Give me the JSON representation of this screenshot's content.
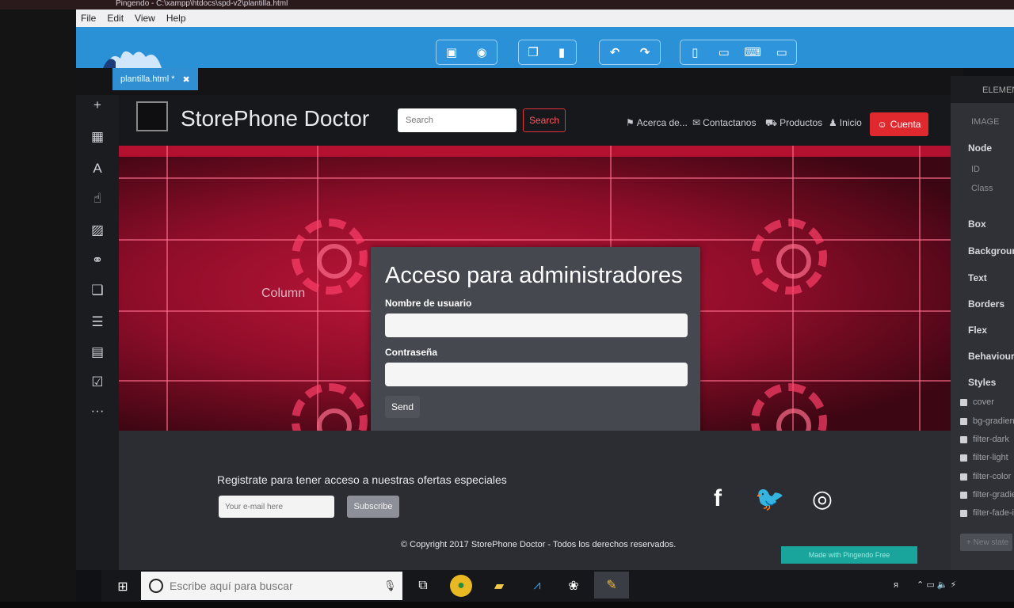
{
  "window": {
    "title": "Pingendo - C:\\xampp\\htdocs\\spd-v2\\plantilla.html",
    "menu": [
      "File",
      "Edit",
      "View",
      "Help"
    ]
  },
  "editor_tab": {
    "label": "plantilla.html *",
    "close_icon": "close-icon"
  },
  "toolbar_groups": [
    [
      "save-icon",
      "preview-eye-icon"
    ],
    [
      "duplicate-icon",
      "trash-icon"
    ],
    [
      "undo-icon",
      "redo-icon"
    ],
    [
      "phone-icon",
      "tablet-icon",
      "laptop-icon",
      "desktop-icon"
    ]
  ],
  "left_tools": [
    "plus-icon",
    "grid-icon",
    "text-A-icon",
    "hand-pointer-icon",
    "image-icon",
    "link-icon",
    "square-icon",
    "list-icon",
    "card-icon",
    "checkbox-icon",
    "more-icon"
  ],
  "site": {
    "brand": "StorePhone Doctor",
    "search_placeholder": "Search",
    "search_button": "Search",
    "nav": [
      {
        "icon": "bookmark-icon",
        "label": "Acerca de..."
      },
      {
        "icon": "envelope-icon",
        "label": "Contactanos"
      },
      {
        "icon": "cart-icon",
        "label": "Productos"
      },
      {
        "icon": "user-icon",
        "label": "Inicio"
      }
    ],
    "account_button": "Cuenta",
    "hero_column_label": "Column",
    "login": {
      "title": "Acceso para administradores",
      "username_label": "Nombre de usuario",
      "password_label": "Contraseña",
      "send_button": "Send"
    },
    "footer": {
      "signup_text": "Registrate para tener acceso a nuestras ofertas especiales",
      "email_placeholder": "Your e-mail here",
      "subscribe_button": "Subscribe",
      "social": [
        "facebook-icon",
        "twitter-icon",
        "instagram-icon"
      ],
      "copyright": "© Copyright 2017 StorePhone Doctor - Todos los derechos reservados.",
      "made_with": "Made with Pingendo Free"
    }
  },
  "right_panel": {
    "header": "ELEMENT",
    "image_label": "IMAGE",
    "node": "Node",
    "node_fields": [
      "ID",
      "Class"
    ],
    "sections": [
      "Box",
      "Background",
      "Text",
      "Borders",
      "Flex",
      "Behaviours",
      "Styles"
    ],
    "styles": [
      "cover",
      "bg-gradient",
      "filter-dark",
      "filter-light",
      "filter-color",
      "filter-gradient",
      "filter-fade-in"
    ],
    "new_state": "+ New state"
  },
  "taskbar": {
    "search_placeholder": "Escribe aquí para buscar",
    "apps": [
      "task-view-icon",
      "chrome-icon",
      "file-explorer-icon",
      "vscode-icon",
      "paw-icon",
      "pingendo-icon"
    ]
  },
  "colors": {
    "toolbar_blue": "#2b91d6",
    "accent_red": "#e0282f",
    "made_with_teal": "#1aa59c"
  }
}
